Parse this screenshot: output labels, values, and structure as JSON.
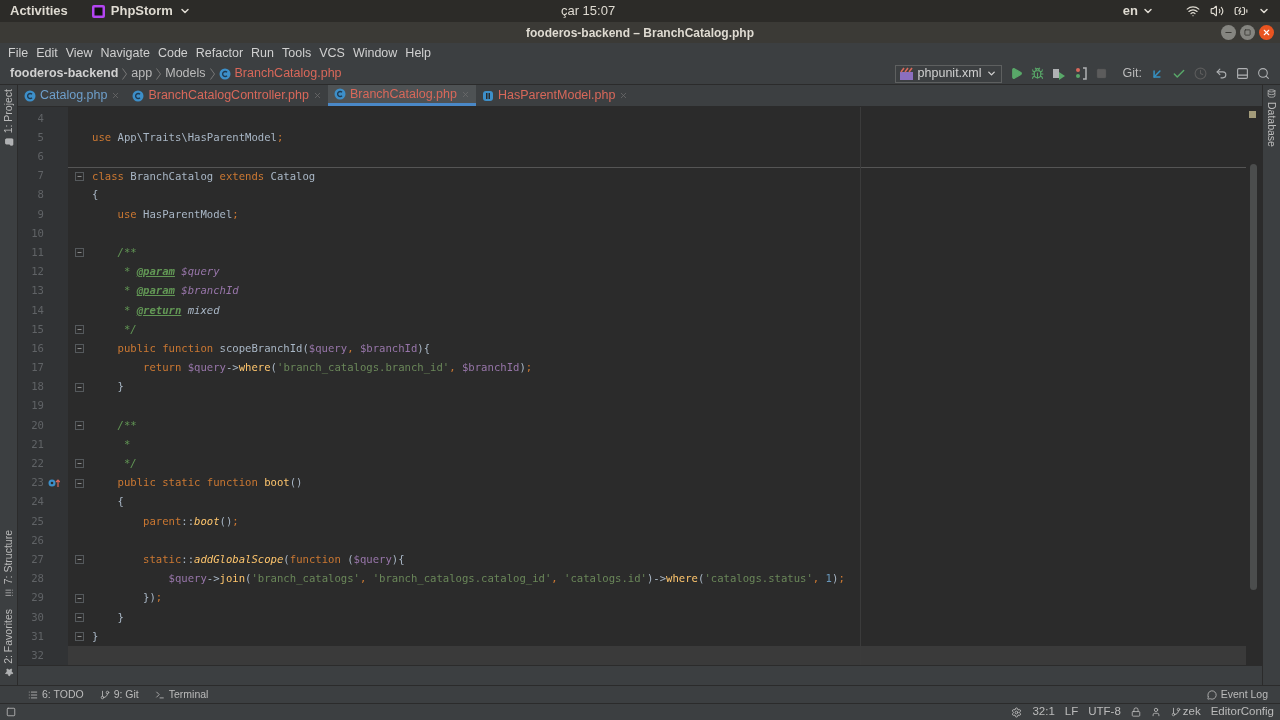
{
  "top_bar": {
    "activities": "Activities",
    "app": "PhpStorm",
    "clock": "çar 15:07",
    "language": "en"
  },
  "window": {
    "title": "fooderos-backend – BranchCatalog.php"
  },
  "menu": [
    "File",
    "Edit",
    "View",
    "Navigate",
    "Code",
    "Refactor",
    "Run",
    "Tools",
    "VCS",
    "Window",
    "Help"
  ],
  "breadcrumbs": [
    {
      "label": "fooderos-backend",
      "kind": "project"
    },
    {
      "label": "app",
      "kind": "folder"
    },
    {
      "label": "Models",
      "kind": "folder"
    },
    {
      "label": "BranchCatalog.php",
      "kind": "file"
    }
  ],
  "toolbar": {
    "run_config": "phpunit.xml",
    "git_label": "Git:"
  },
  "tabs": [
    {
      "label": "Catalog.php",
      "kind": "class",
      "color": "#6e9fcb",
      "selected": false
    },
    {
      "label": "BranchCatalogController.php",
      "kind": "class",
      "color": "#d9685a",
      "selected": false
    },
    {
      "label": "BranchCatalog.php",
      "kind": "class",
      "color": "#d9685a",
      "selected": true
    },
    {
      "label": "HasParentModel.php",
      "kind": "trait",
      "color": "#d9685a",
      "selected": false
    }
  ],
  "left_panels": [
    {
      "label": "1: Project"
    },
    {
      "label": "7: Structure"
    },
    {
      "label": "2: Favorites"
    }
  ],
  "right_panels": [
    {
      "label": "Database"
    }
  ],
  "editor": {
    "lines": [
      {
        "number": "4",
        "fold": false
      },
      {
        "number": "5",
        "fold": false,
        "tokens": [
          {
            "kind": "keyword",
            "text": "use"
          },
          {
            "kind": "plain",
            "text": " App\\Traits\\HasParentModel"
          },
          {
            "kind": "keyword",
            "text": ";"
          }
        ]
      },
      {
        "number": "6",
        "fold": false
      },
      {
        "number": "7",
        "fold": true,
        "separator": true,
        "tokens": [
          {
            "kind": "keyword",
            "text": "class"
          },
          {
            "kind": "plain",
            "text": " BranchCatalog "
          },
          {
            "kind": "keyword",
            "text": "extends"
          },
          {
            "kind": "plain",
            "text": " Catalog"
          }
        ]
      },
      {
        "number": "8",
        "fold": false,
        "tokens": [
          {
            "kind": "plain",
            "text": "{"
          }
        ]
      },
      {
        "number": "9",
        "fold": false,
        "tokens": [
          {
            "kind": "keyword",
            "text": "    use"
          },
          {
            "kind": "plain",
            "text": " HasParentModel"
          },
          {
            "kind": "keyword",
            "text": ";"
          }
        ]
      },
      {
        "number": "10",
        "fold": false
      },
      {
        "number": "11",
        "fold": true,
        "tokens": [
          {
            "kind": "comment",
            "text": "    /**"
          }
        ]
      },
      {
        "number": "12",
        "fold": false,
        "tokens": [
          {
            "kind": "comment",
            "text": "     * "
          },
          {
            "kind": "doctag",
            "text": "@param"
          },
          {
            "kind": "docvar",
            "text": " $query"
          }
        ]
      },
      {
        "number": "13",
        "fold": false,
        "tokens": [
          {
            "kind": "comment",
            "text": "     * "
          },
          {
            "kind": "doctag",
            "text": "@param"
          },
          {
            "kind": "docvar",
            "text": " $branchId"
          }
        ]
      },
      {
        "number": "14",
        "fold": false,
        "tokens": [
          {
            "kind": "comment",
            "text": "     * "
          },
          {
            "kind": "doctag",
            "text": "@return"
          },
          {
            "kind": "doctype",
            "text": " mixed"
          }
        ]
      },
      {
        "number": "15",
        "fold": true,
        "tokens": [
          {
            "kind": "comment",
            "text": "     */"
          }
        ]
      },
      {
        "number": "16",
        "fold": true,
        "tokens": [
          {
            "kind": "keyword",
            "text": "    public function"
          },
          {
            "kind": "plain",
            "text": " scopeBranchId("
          },
          {
            "kind": "variable",
            "text": "$query"
          },
          {
            "kind": "keyword",
            "text": ","
          },
          {
            "kind": "variable",
            "text": " $branchId"
          },
          {
            "kind": "plain",
            "text": "){"
          }
        ]
      },
      {
        "number": "17",
        "fold": false,
        "tokens": [
          {
            "kind": "keyword",
            "text": "        return"
          },
          {
            "kind": "variable",
            "text": " $query"
          },
          {
            "kind": "plain",
            "text": "->"
          },
          {
            "kind": "call",
            "text": "where"
          },
          {
            "kind": "plain",
            "text": "("
          },
          {
            "kind": "string",
            "text": "'branch_catalogs.branch_id'"
          },
          {
            "kind": "keyword",
            "text": ","
          },
          {
            "kind": "variable",
            "text": " $branchId"
          },
          {
            "kind": "plain",
            "text": ")"
          },
          {
            "kind": "keyword",
            "text": ";"
          }
        ]
      },
      {
        "number": "18",
        "fold": true,
        "tokens": [
          {
            "kind": "plain",
            "text": "    }"
          }
        ]
      },
      {
        "number": "19",
        "fold": false
      },
      {
        "number": "20",
        "fold": true,
        "tokens": [
          {
            "kind": "comment",
            "text": "    /**"
          }
        ]
      },
      {
        "number": "21",
        "fold": false,
        "tokens": [
          {
            "kind": "comment",
            "text": "     *"
          }
        ]
      },
      {
        "number": "22",
        "fold": true,
        "tokens": [
          {
            "kind": "comment",
            "text": "     */"
          }
        ]
      },
      {
        "number": "23",
        "fold": true,
        "override_marker": true,
        "tokens": [
          {
            "kind": "keyword",
            "text": "    public static function"
          },
          {
            "kind": "call",
            "text": " boot"
          },
          {
            "kind": "plain",
            "text": "()"
          }
        ]
      },
      {
        "number": "24",
        "fold": false,
        "tokens": [
          {
            "kind": "plain",
            "text": "    {"
          }
        ]
      },
      {
        "number": "25",
        "fold": false,
        "tokens": [
          {
            "kind": "keyword",
            "text": "        parent"
          },
          {
            "kind": "plain",
            "text": "::"
          },
          {
            "kind": "static_call",
            "text": "boot"
          },
          {
            "kind": "plain",
            "text": "()"
          },
          {
            "kind": "keyword",
            "text": ";"
          }
        ]
      },
      {
        "number": "26",
        "fold": false
      },
      {
        "number": "27",
        "fold": true,
        "tokens": [
          {
            "kind": "keyword",
            "text": "        static"
          },
          {
            "kind": "plain",
            "text": "::"
          },
          {
            "kind": "static_call",
            "text": "addGlobalScope"
          },
          {
            "kind": "plain",
            "text": "("
          },
          {
            "kind": "keyword",
            "text": "function"
          },
          {
            "kind": "plain",
            "text": " ("
          },
          {
            "kind": "variable",
            "text": "$query"
          },
          {
            "kind": "plain",
            "text": "){"
          }
        ]
      },
      {
        "number": "28",
        "fold": false,
        "tokens": [
          {
            "kind": "variable",
            "text": "            $query"
          },
          {
            "kind": "plain",
            "text": "->"
          },
          {
            "kind": "call",
            "text": "join"
          },
          {
            "kind": "plain",
            "text": "("
          },
          {
            "kind": "string",
            "text": "'branch_catalogs'"
          },
          {
            "kind": "keyword",
            "text": ","
          },
          {
            "kind": "string",
            "text": " 'branch_catalogs.catalog_id'"
          },
          {
            "kind": "keyword",
            "text": ","
          },
          {
            "kind": "string",
            "text": " 'catalogs.id'"
          },
          {
            "kind": "plain",
            "text": ")->"
          },
          {
            "kind": "call",
            "text": "where"
          },
          {
            "kind": "plain",
            "text": "("
          },
          {
            "kind": "string",
            "text": "'catalogs.status'"
          },
          {
            "kind": "keyword",
            "text": ","
          },
          {
            "kind": "number",
            "text": " 1"
          },
          {
            "kind": "plain",
            "text": ")"
          },
          {
            "kind": "keyword",
            "text": ";"
          }
        ]
      },
      {
        "number": "29",
        "fold": true,
        "tokens": [
          {
            "kind": "plain",
            "text": "        })"
          },
          {
            "kind": "keyword",
            "text": ";"
          }
        ]
      },
      {
        "number": "30",
        "fold": true,
        "tokens": [
          {
            "kind": "plain",
            "text": "    }"
          }
        ]
      },
      {
        "number": "31",
        "fold": true,
        "tokens": [
          {
            "kind": "plain",
            "text": "}"
          }
        ]
      },
      {
        "number": "32",
        "fold": false,
        "current": true
      }
    ]
  },
  "tool_windows": [
    {
      "label": "6: TODO",
      "kind": "todo"
    },
    {
      "label": "9: Git",
      "kind": "git"
    },
    {
      "label": "Terminal",
      "kind": "terminal"
    }
  ],
  "event_log": "Event Log",
  "status_bar": {
    "position": "32:1",
    "line_ending": "LF",
    "encoding": "UTF-8",
    "branch": "zek",
    "editorconfig": "EditorConfig"
  }
}
